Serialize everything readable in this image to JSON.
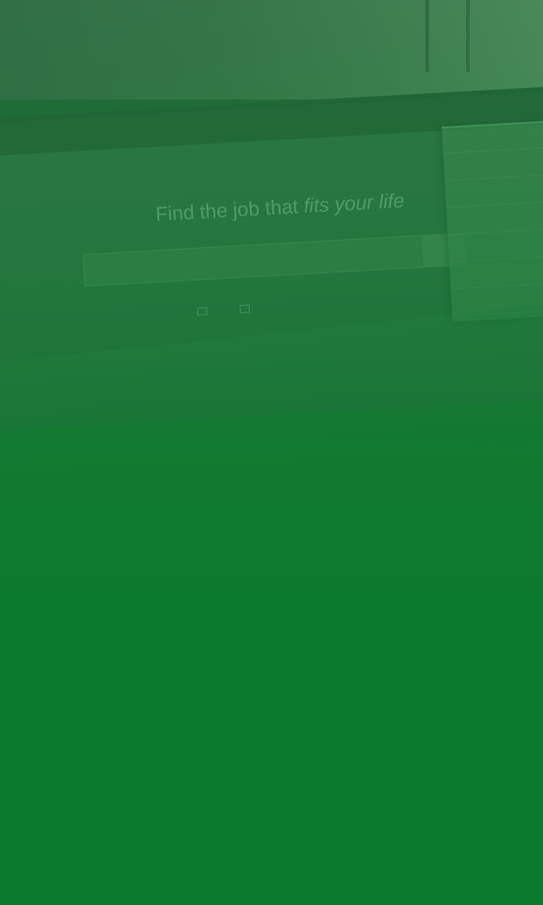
{
  "colors": {
    "overlay_green": "#0c7a2e",
    "dark_band": "#2f5f3e"
  },
  "site": {
    "logo_text": "",
    "hero_title_plain": "Find the job that ",
    "hero_title_italic": "fits your life",
    "search": {
      "what_placeholder": "",
      "where_placeholder": "",
      "button_label": ""
    },
    "links": [
      {
        "label": "",
        "icon": "upload-icon"
      },
      {
        "label": "",
        "icon": "resume-icon"
      }
    ]
  },
  "dropdown": {
    "header": "",
    "items": [
      {
        "label": ""
      },
      {
        "label": ""
      },
      {
        "label": ""
      },
      {
        "label": ""
      },
      {
        "label": ""
      },
      {
        "label": ""
      },
      {
        "label": ""
      }
    ]
  }
}
